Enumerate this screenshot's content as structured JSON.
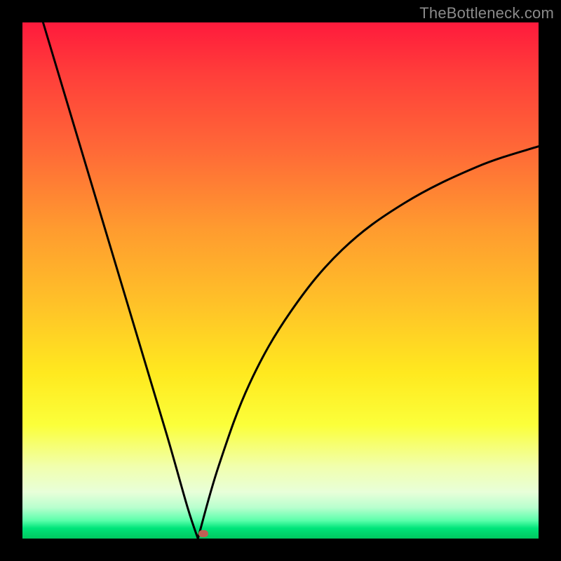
{
  "watermark": "TheBottleneck.com",
  "colors": {
    "bg": "#000000",
    "curve": "#000000",
    "marker": "#c06055",
    "gradient_stops": [
      "#ff1a3c",
      "#ff3e3a",
      "#ff6a37",
      "#ff9b2f",
      "#ffc328",
      "#ffe91f",
      "#fbff3a",
      "#f1ffad",
      "#e8ffd9",
      "#b8ffce",
      "#5bffab",
      "#00e47a",
      "#00c85f"
    ]
  },
  "chart_data": {
    "type": "line",
    "title": "",
    "xlabel": "",
    "ylabel": "",
    "xlim": [
      0,
      100
    ],
    "ylim": [
      0,
      100
    ],
    "note": "V-shaped bottleneck curve; minimum at x≈34, y≈0. Left branch near-linear from (4,100) to (34,0); right branch concave rising to (100,~76).",
    "series": [
      {
        "name": "left-branch",
        "x": [
          4,
          10,
          16,
          22,
          28,
          32,
          34
        ],
        "y": [
          100,
          80,
          60,
          40,
          20,
          6,
          0
        ]
      },
      {
        "name": "right-branch",
        "x": [
          34,
          38,
          44,
          52,
          62,
          74,
          88,
          100
        ],
        "y": [
          0,
          14,
          30,
          44,
          56,
          65,
          72,
          76
        ]
      }
    ],
    "marker": {
      "x": 35,
      "y": 1
    }
  }
}
